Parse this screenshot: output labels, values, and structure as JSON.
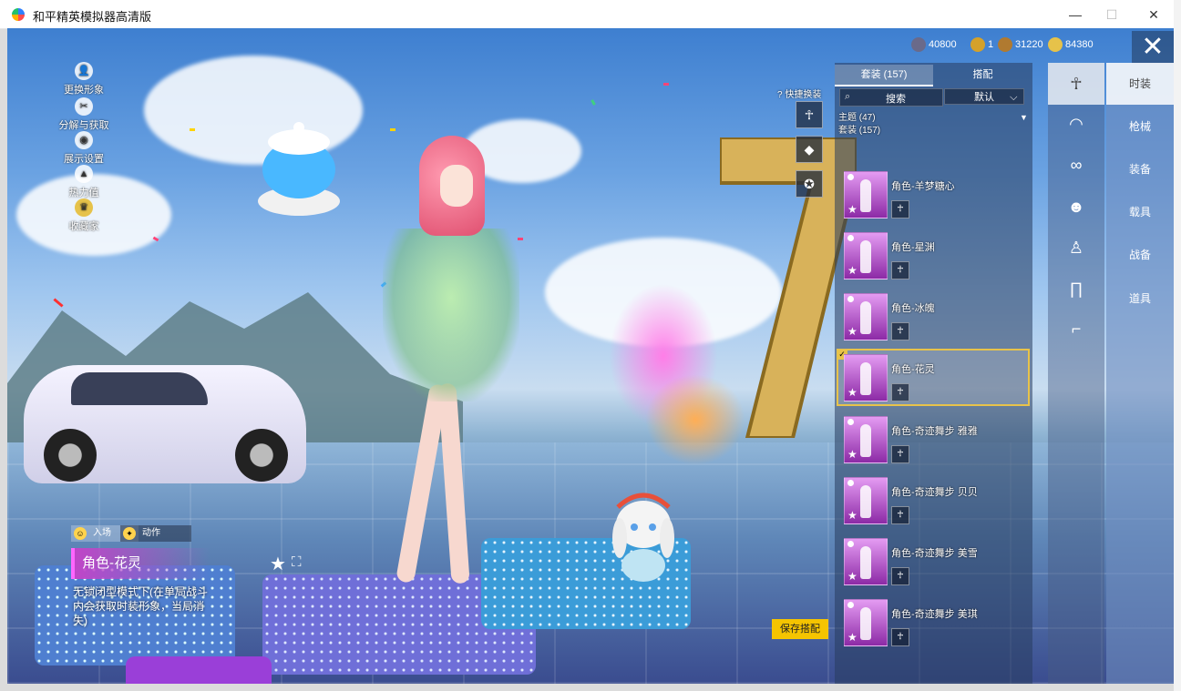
{
  "window": {
    "title": "和平精英模拟器高清版"
  },
  "currency": [
    {
      "icon": "token-icon",
      "value": "40800",
      "color": "#6a6a8a"
    },
    {
      "icon": "coin-icon",
      "value": "1",
      "color": "#d4a12a"
    },
    {
      "icon": "medal-icon",
      "value": "31220",
      "color": "#b07a30"
    },
    {
      "icon": "diamond-icon",
      "value": "84380",
      "color": "#e6c24a"
    }
  ],
  "left_menu": [
    {
      "label": "更换形象",
      "icon": "person-icon"
    },
    {
      "label": "分解与获取",
      "icon": "scissors-icon"
    },
    {
      "label": "展示设置",
      "icon": "eye-icon"
    },
    {
      "label": "热力值",
      "icon": "flame-icon"
    },
    {
      "label": "收藏家",
      "icon": "crown-badge-icon"
    }
  ],
  "bottom_left": {
    "tabs": [
      {
        "label": "入场",
        "icon": "smile-icon"
      },
      {
        "label": "动作",
        "icon": "action-icon"
      }
    ],
    "outfit_name": "角色-花灵",
    "description": "无锁闭型模式下(在单局战斗内会获取时装形象，当局消失)",
    "star_icon": "star-icon",
    "expand_icon": "expand-icon"
  },
  "save_button": "保存搭配",
  "quick_switch": {
    "label": "快捷换装"
  },
  "wardrobe": {
    "tabs": [
      {
        "label": "套装 (157)",
        "active": true
      },
      {
        "label": "搭配",
        "active": false
      }
    ],
    "search_label": "搜索",
    "sort_label": "默认",
    "filter_lines": [
      "主题 (47)",
      "套装 (157)"
    ],
    "items": [
      {
        "name": "角色-羊梦糖心",
        "selected": false
      },
      {
        "name": "角色-星渊",
        "selected": false
      },
      {
        "name": "角色-冰魄",
        "selected": false
      },
      {
        "name": "角色-花灵",
        "selected": true
      },
      {
        "name": "角色-奇迹舞步 雅雅",
        "selected": false
      },
      {
        "name": "角色-奇迹舞步 贝贝",
        "selected": false
      },
      {
        "name": "角色-奇迹舞步 美雪",
        "selected": false
      },
      {
        "name": "角色-奇迹舞步 美琪",
        "selected": false
      }
    ]
  },
  "categories": [
    {
      "icon": "full-body-icon",
      "active": true
    },
    {
      "icon": "cap-icon",
      "active": false
    },
    {
      "icon": "glasses-icon",
      "active": false
    },
    {
      "icon": "mask-icon",
      "active": false
    },
    {
      "icon": "top-icon",
      "active": false
    },
    {
      "icon": "pants-icon",
      "active": false
    },
    {
      "icon": "shoes-icon",
      "active": false
    }
  ],
  "right_nav": [
    {
      "label": "时装",
      "active": true
    },
    {
      "label": "枪械",
      "active": false
    },
    {
      "label": "装备",
      "active": false
    },
    {
      "label": "载具",
      "active": false
    },
    {
      "label": "战备",
      "active": false
    },
    {
      "label": "道具",
      "active": false
    }
  ]
}
